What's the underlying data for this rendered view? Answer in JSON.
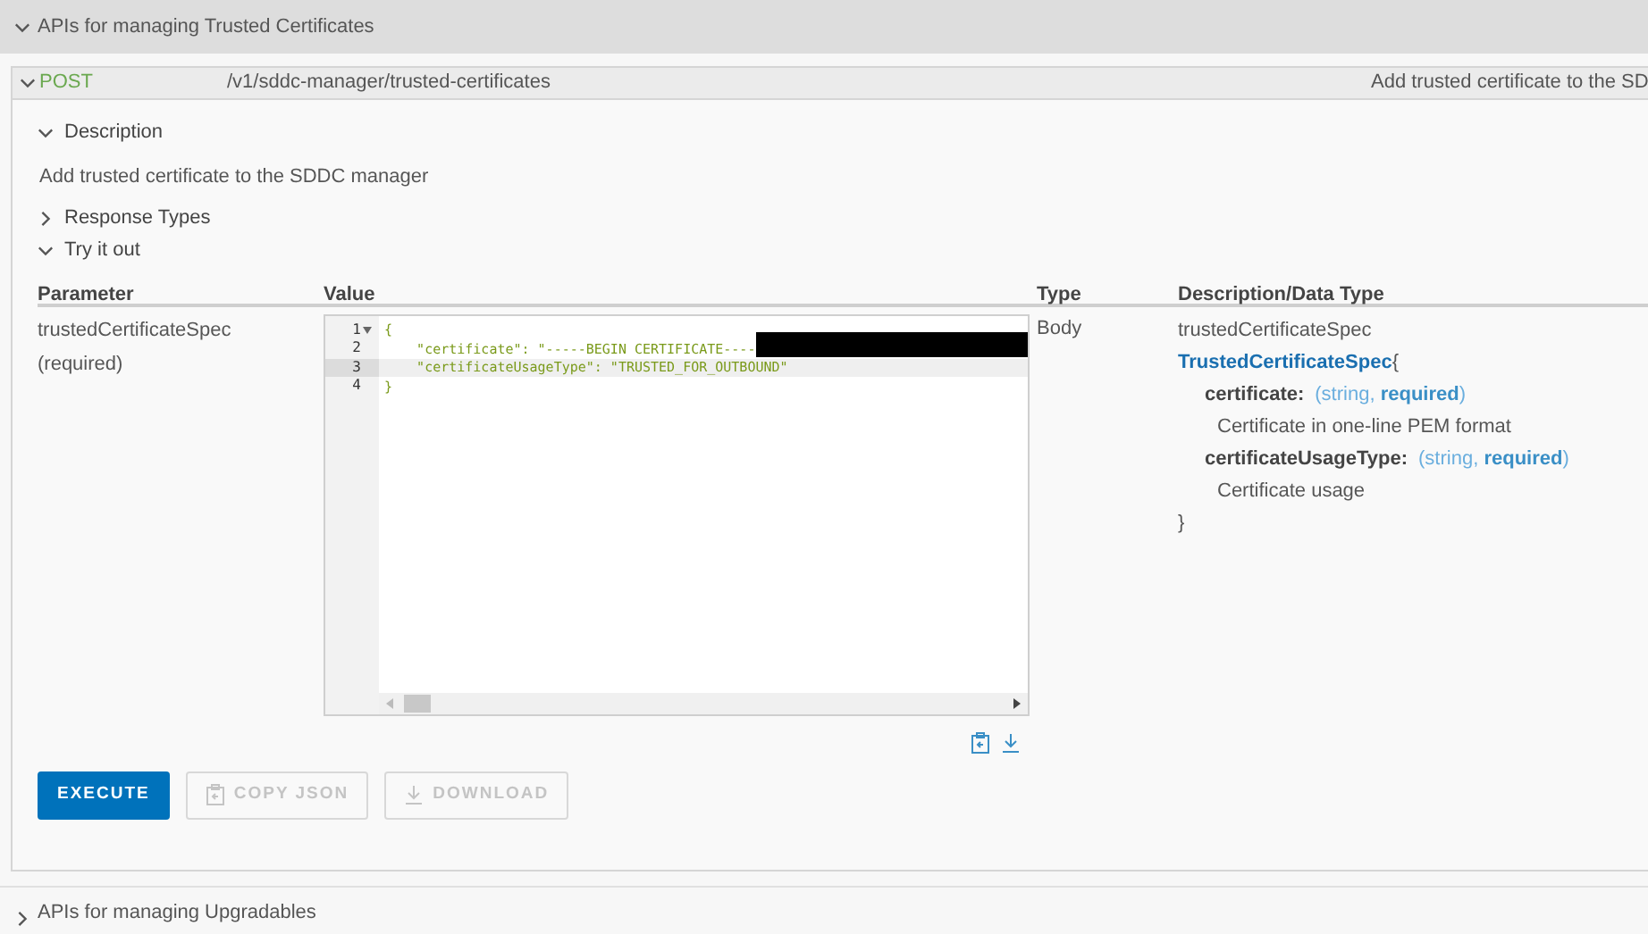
{
  "groups": [
    {
      "title": "APIs for managing Trusted Certificates",
      "expanded": true
    },
    {
      "title": "APIs for managing Upgradables",
      "expanded": false
    }
  ],
  "endpoint": {
    "method": "POST",
    "path": "/v1/sddc-manager/trusted-certificates",
    "summary": "Add trusted certificate to the SD",
    "expanded": true
  },
  "sections": [
    {
      "title": "Description",
      "expanded": true,
      "body": "Add trusted certificate to the SDDC manager"
    },
    {
      "title": "Response Types",
      "expanded": false
    },
    {
      "title": "Try it out",
      "expanded": true
    }
  ],
  "table": {
    "columns": [
      "Parameter",
      "Value",
      "Type",
      "Description/Data Type"
    ],
    "param": {
      "name": "trustedCertificateSpec",
      "required": "(required)"
    },
    "editor": {
      "lines": [
        {
          "number": "1",
          "text": "{",
          "foldable": true,
          "active": false
        },
        {
          "number": "2",
          "text": "    \"certificate\": \"-----BEGIN CERTIFICATE----",
          "foldable": false,
          "active": false,
          "redacted": true
        },
        {
          "number": "3",
          "text": "    \"certificateUsageType\": \"TRUSTED_FOR_OUTBOUND\"",
          "foldable": false,
          "active": true
        },
        {
          "number": "4",
          "text": "}",
          "foldable": false,
          "active": false
        }
      ]
    },
    "type": "Body",
    "schema": {
      "param_name": "trustedCertificateSpec",
      "model": "TrustedCertificateSpec",
      "open_brace": "{",
      "close_brace": "}",
      "properties": [
        {
          "name": "certificate:",
          "meta": "(string, **required**)",
          "description": "Certificate in one-line PEM format"
        },
        {
          "name": "certificateUsageType:",
          "meta": "(string, **required**)",
          "description": "Certificate usage"
        }
      ]
    }
  },
  "buttons": [
    {
      "label": "EXECUTE",
      "kind": "primary",
      "disabled": false
    },
    {
      "label": "COPY JSON",
      "kind": "copy",
      "disabled": true
    },
    {
      "label": "DOWNLOAD",
      "kind": "download",
      "disabled": true
    }
  ]
}
